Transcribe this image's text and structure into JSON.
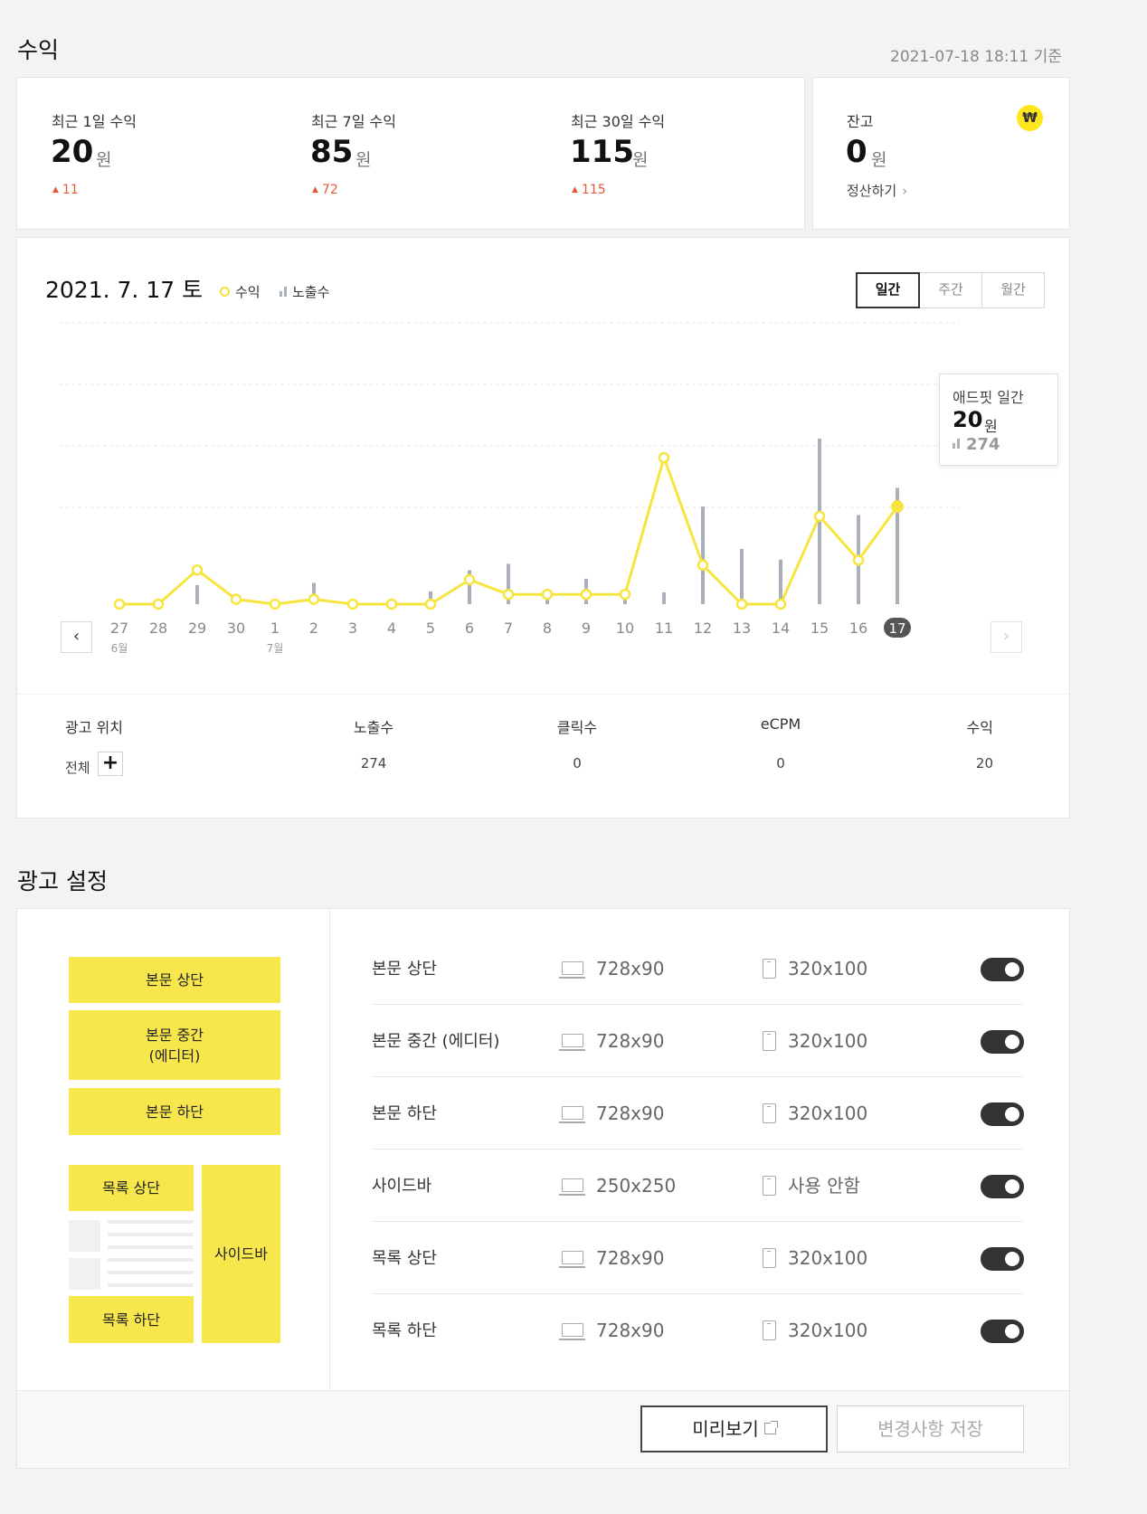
{
  "revenue": {
    "title": "수익",
    "timestamp": "2021-07-18 18:11 기준",
    "stats": [
      {
        "label": "최근 1일 수익",
        "value": "20",
        "unit": "원",
        "delta": "11"
      },
      {
        "label": "최근 7일 수익",
        "value": "85",
        "unit": "원",
        "delta": "72"
      },
      {
        "label": "최근 30일 수익",
        "value": "115",
        "unit": "원",
        "delta": "115"
      }
    ],
    "balance": {
      "label": "잔고",
      "value": "0",
      "unit": "원",
      "icon": "won-icon",
      "icon_glyph": "₩",
      "settle_label": "정산하기",
      "settle_chevron": "›",
      "icon_color": "#ffe51b"
    }
  },
  "chart": {
    "date_label": "2021. 7. 17 토",
    "legend_revenue": "수익",
    "legend_impressions": "노출수",
    "period_tabs": [
      "일간",
      "주간",
      "월간"
    ],
    "active_tab": 0,
    "prev_arrow": "‹",
    "next_arrow": "›",
    "tooltip": {
      "title": "애드핏 일간",
      "value": "20",
      "unit": "원",
      "impressions": "274"
    },
    "line_color": "#f6e53f",
    "bar_color": "#aab0ba"
  },
  "chart_data": {
    "type": "line",
    "categories": [
      "27",
      "28",
      "29",
      "30",
      "1",
      "2",
      "3",
      "4",
      "5",
      "6",
      "7",
      "8",
      "9",
      "10",
      "11",
      "12",
      "13",
      "14",
      "15",
      "16",
      "17"
    ],
    "month_labels": [
      {
        "index": 0,
        "label": "6월"
      },
      {
        "index": 4,
        "label": "7월"
      }
    ],
    "series": [
      {
        "name": "수익",
        "kind": "line",
        "values": [
          0,
          0,
          14,
          2,
          0,
          2,
          0,
          0,
          0,
          10,
          4,
          4,
          4,
          4,
          60,
          16,
          0,
          0,
          36,
          18,
          40
        ]
      },
      {
        "name": "노출수",
        "kind": "bar",
        "values": [
          0,
          0,
          45,
          0,
          0,
          50,
          0,
          0,
          30,
          80,
          95,
          35,
          60,
          35,
          28,
          230,
          130,
          105,
          390,
          210,
          274
        ]
      }
    ],
    "highlight_index": 20,
    "grid": true
  },
  "table": {
    "headers": [
      "광고 위치",
      "노출수",
      "클릭수",
      "eCPM",
      "수익"
    ],
    "row": {
      "name": "전체",
      "plus": "+",
      "impressions": "274",
      "clicks": "0",
      "ecpm": "0",
      "revenue": "20"
    }
  },
  "ad_settings": {
    "title": "광고 설정",
    "diagram": {
      "body_top": "본문 상단",
      "body_middle_line1": "본문 중간",
      "body_middle_line2": "(에디터)",
      "body_bottom": "본문 하단",
      "list_top": "목록 상단",
      "list_bottom": "목록 하단",
      "sidebar": "사이드바"
    },
    "rows": [
      {
        "name": "본문 상단",
        "pc": "728x90",
        "mobile": "320x100",
        "enabled": true
      },
      {
        "name": "본문 중간 (에디터)",
        "pc": "728x90",
        "mobile": "320x100",
        "enabled": true
      },
      {
        "name": "본문 하단",
        "pc": "728x90",
        "mobile": "320x100",
        "enabled": true
      },
      {
        "name": "사이드바",
        "pc": "250x250",
        "mobile": "사용 안함",
        "enabled": true
      },
      {
        "name": "목록 상단",
        "pc": "728x90",
        "mobile": "320x100",
        "enabled": true
      },
      {
        "name": "목록 하단",
        "pc": "728x90",
        "mobile": "320x100",
        "enabled": true
      }
    ],
    "preview_button": "미리보기",
    "save_button": "변경사항 저장",
    "accent_color": "#f8e64d"
  }
}
